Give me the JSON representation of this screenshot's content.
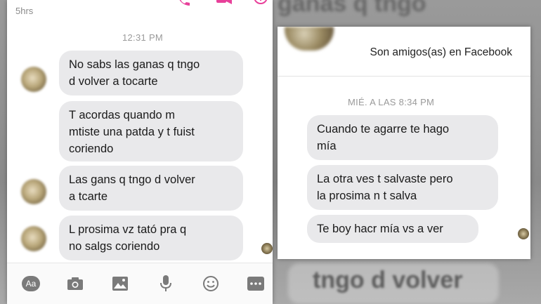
{
  "left_chat": {
    "status_time": "5hrs",
    "timestamp": "12:31 PM",
    "messages": [
      "No sabs las ganas q tngo\nd volver a tocarte",
      "T acordas quando m\nmtiste una patda y t fuist\ncoriendo",
      "Las gans q tngo d volver\na tcarte",
      "L prosima vz tató pra q\nno salgs coriendo"
    ],
    "toolbar": {
      "text_button": "Aa"
    }
  },
  "right_chat": {
    "friends_label": "Son amigos(as) en Facebook",
    "timestamp": "MIÉ. A LAS 8:34 PM",
    "messages": [
      "Cuando te agarre te hago\nmía",
      "La otra ves t salvaste pero\nla prosima n t salva",
      "Te boy hacr mía vs a ver"
    ]
  },
  "background": {
    "blur_text_bottom": "tngo d volver",
    "blur_text_top": "ganas q tngo"
  },
  "colors": {
    "bubble": "#e9e9eb",
    "accent_pink": "#e8409a",
    "card": "#ffffff"
  }
}
